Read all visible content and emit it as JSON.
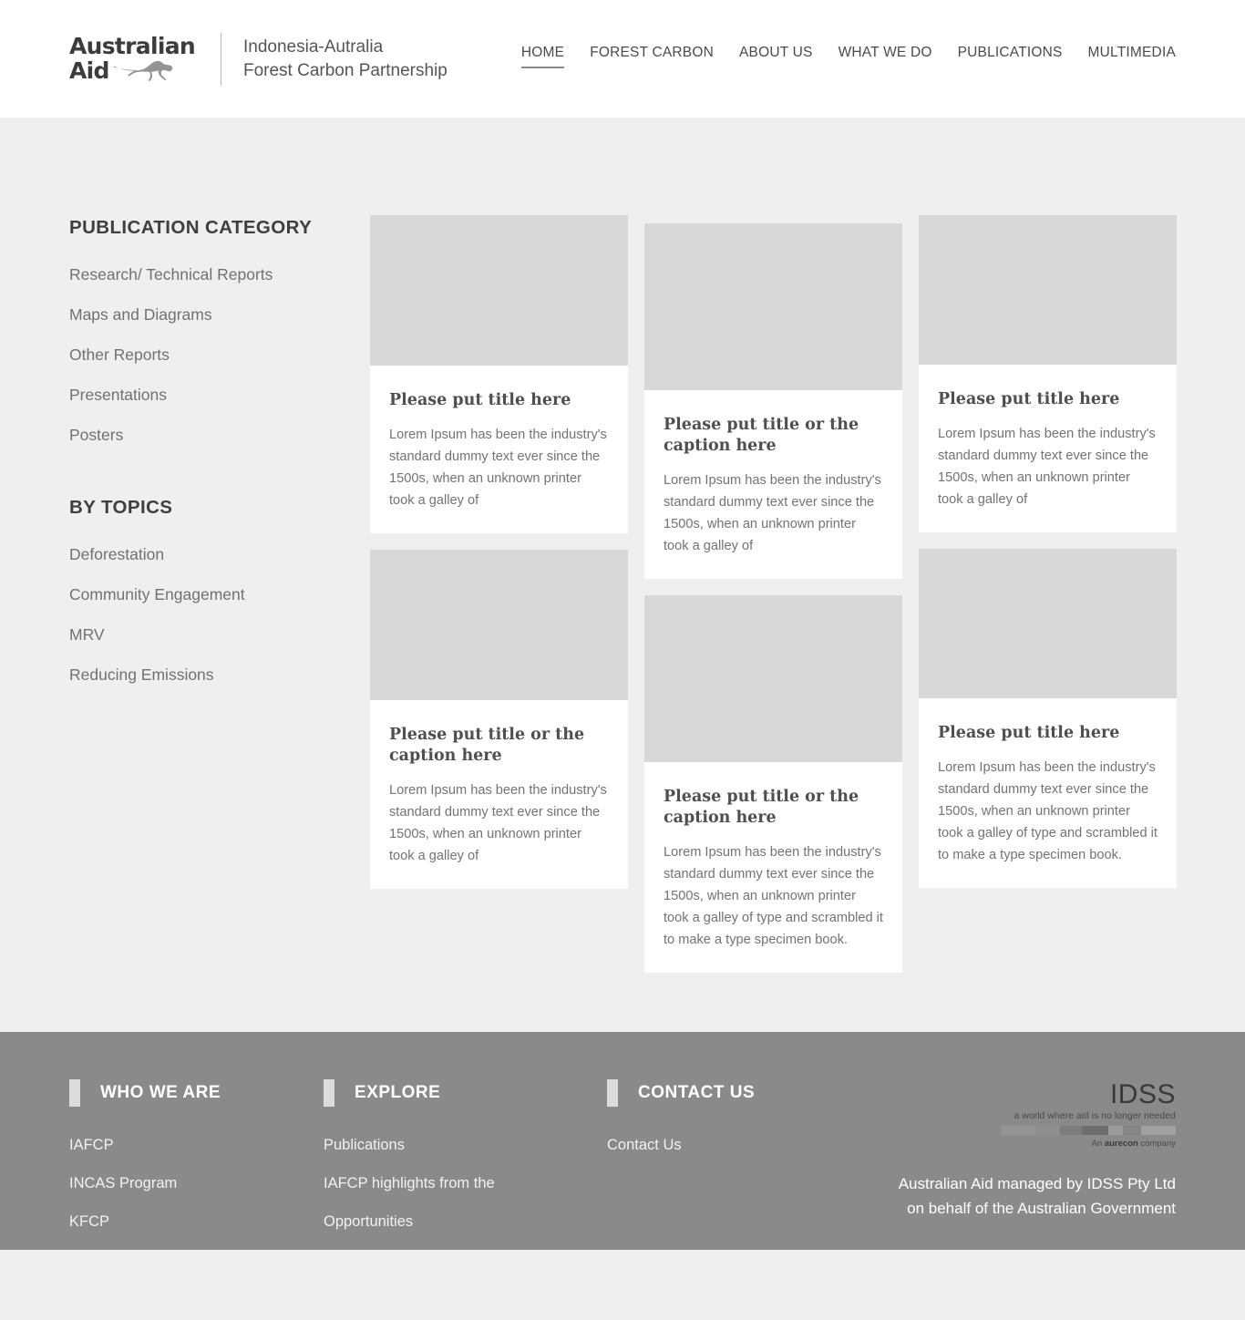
{
  "header": {
    "logo": {
      "line1": "Australian",
      "line2": "Aid",
      "icon": "kangaroo-icon"
    },
    "brand_title_line1": "Indonesia-Autralia",
    "brand_title_line2": "Forest Carbon Partnership",
    "nav": [
      {
        "label": "HOME",
        "active": true
      },
      {
        "label": "FOREST CARBON",
        "active": false
      },
      {
        "label": "ABOUT US",
        "active": false
      },
      {
        "label": "WHAT WE DO",
        "active": false
      },
      {
        "label": "PUBLICATIONS",
        "active": false
      },
      {
        "label": "MULTIMEDIA",
        "active": false
      }
    ]
  },
  "sidebar": {
    "category_heading": "PUBLICATION CATEGORY",
    "categories": [
      {
        "label": "Research/ Technical Reports"
      },
      {
        "label": "Maps and Diagrams"
      },
      {
        "label": "Other Reports"
      },
      {
        "label": "Presentations"
      },
      {
        "label": "Posters"
      }
    ],
    "topics_heading": "BY TOPICS",
    "topics": [
      {
        "label": "Deforestation"
      },
      {
        "label": "Community Engagement"
      },
      {
        "label": "MRV"
      },
      {
        "label": "Reducing Emissions"
      }
    ]
  },
  "cards": {
    "col_a": [
      {
        "title": "Please put title here",
        "text": "Lorem Ipsum has been the industry's standard dummy text ever since the 1500s, when an unknown printer took a galley of",
        "thumb_height": 165
      },
      {
        "title": "Please put title or the caption here",
        "text": "Lorem Ipsum has been the industry's standard dummy text ever since the 1500s, when an unknown printer took a galley of",
        "thumb_height": 165
      }
    ],
    "col_b": [
      {
        "title": "Please put title or the caption here",
        "text": "Lorem Ipsum has been the industry's standard dummy text ever since the 1500s, when an unknown printer took a galley of",
        "thumb_height": 183
      },
      {
        "title": "Please put title or the caption here",
        "text": "Lorem Ipsum has been the industry's standard dummy text ever since the 1500s, when an unknown printer took a galley of type and scrambled it to make a type specimen book.",
        "thumb_height": 183
      }
    ],
    "col_c": [
      {
        "title": "Please put title here",
        "text": "Lorem Ipsum has been the industry's standard dummy text ever since the 1500s, when an unknown printer took a galley of",
        "thumb_height": 164
      },
      {
        "title": "Please put title here",
        "text": "Lorem Ipsum has been the industry's standard dummy text ever since the 1500s, when an unknown printer took a galley of type and scrambled it to make a type specimen book.",
        "thumb_height": 164
      }
    ]
  },
  "footer": {
    "columns": [
      {
        "heading": "WHO WE ARE",
        "links": [
          {
            "label": "IAFCP"
          },
          {
            "label": "INCAS Program"
          },
          {
            "label": "KFCP"
          }
        ]
      },
      {
        "heading": "EXPLORE",
        "links": [
          {
            "label": "Publications"
          },
          {
            "label": "IAFCP highlights from the"
          },
          {
            "label": "Opportunities"
          }
        ]
      },
      {
        "heading": "CONTACT US",
        "links": [
          {
            "label": "Contact Us"
          }
        ]
      }
    ],
    "idss": {
      "name": "IDSS",
      "tagline": "a world where aid is no longer needed",
      "sub_prefix": "An ",
      "sub_brand": "aurecon",
      "sub_suffix": " company"
    },
    "note_line1": "Australian Aid managed by IDSS Pty Ltd",
    "note_line2": "on behalf of the Australian Government"
  },
  "colors": {
    "page_bg": "#efefef",
    "header_bg": "#ffffff",
    "card_bg": "#ffffff",
    "thumb_bg": "#d8d8d8",
    "footer_bg": "#8a8a8a",
    "accent_bar": "#dcdcdc",
    "text_body": "#737373",
    "text_heading": "#3f3f3f"
  }
}
